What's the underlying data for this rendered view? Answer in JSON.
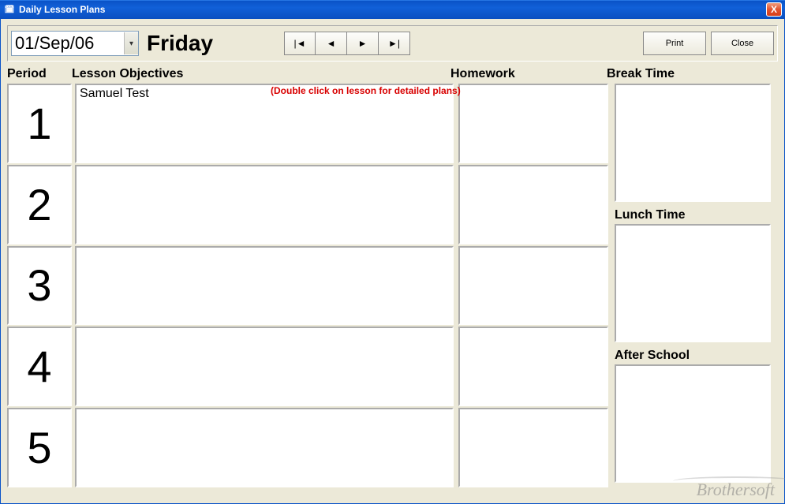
{
  "window": {
    "title": "Daily Lesson Plans",
    "close_glyph": "X"
  },
  "toolbar": {
    "date": "01/Sep/06",
    "day": "Friday",
    "nav_first": "|◄",
    "nav_prev": "◄",
    "nav_next": "►",
    "nav_last": "►|",
    "print": "Print",
    "close": "Close"
  },
  "headers": {
    "period": "Period",
    "lesson": "Lesson Objectives",
    "homework": "Homework",
    "break_time": "Break Time",
    "lunch_time": "Lunch Time",
    "after_school": "After School"
  },
  "hint": "(Double click on lesson for detailed plans)",
  "periods": [
    "1",
    "2",
    "3",
    "4",
    "5"
  ],
  "lessons": [
    "Samuel Test",
    "",
    "",
    "",
    ""
  ],
  "homework": [
    "",
    "",
    "",
    "",
    ""
  ],
  "side": {
    "break_time": "",
    "lunch_time": "",
    "after_school": ""
  },
  "watermark": "Brothersoft"
}
